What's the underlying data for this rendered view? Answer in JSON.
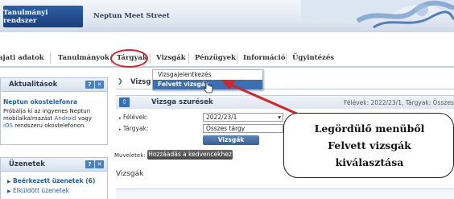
{
  "header": {
    "brand": "Tanulmányi rendszer",
    "site_title": "Neptun Meet Street"
  },
  "menu": {
    "items": [
      "ajati adatok",
      "Tanulmányok",
      "Tárgyak",
      "Vizsgák",
      "Pénzügyek",
      "Információ",
      "Ügyintézés"
    ]
  },
  "dropdown": {
    "items": [
      "Vizsgajelentkezés",
      "Felvett vizsgák"
    ]
  },
  "sidebar": {
    "news_title": "Aktualitások",
    "news_link": "Neptun okostelefonra",
    "news_text_1": "Próbálja ki az ingyenes Neptun",
    "news_text_2": "mobilalkalmazást",
    "news_link_android": "Android",
    "news_text_vagy": "vagy",
    "news_link_ios": "iOS",
    "news_text_3": "rendszeru okostelefonon.",
    "messages_title": "Üzenetek",
    "inbox": "Beérkezett üzenetek (6)",
    "sent": "Elküldött üzenetek"
  },
  "main": {
    "tab_label": "Vizsg",
    "panel_title": "Vizsga szurések",
    "semester_hint": "Félévek: 2022/23/1, Tárgyak: Összes tárgy",
    "semester_label": "Félévek:",
    "semester_value": "2022/23/1",
    "subject_label": "Tárgyak:",
    "subject_value": "Összes tárgy",
    "list_button": "Vizsgák listázása",
    "actions_label": "Muveletek:",
    "add_fav_button": "Hozzáadás a kedvencekhez",
    "section_title": "Vizsgák"
  },
  "callout": {
    "line1": "Legördülő menüből",
    "line2": "Felvett vizsgák",
    "line3": "kiválasztása"
  },
  "colors": {
    "accent": "#3a6fb3",
    "highlight": "#d4232a"
  }
}
